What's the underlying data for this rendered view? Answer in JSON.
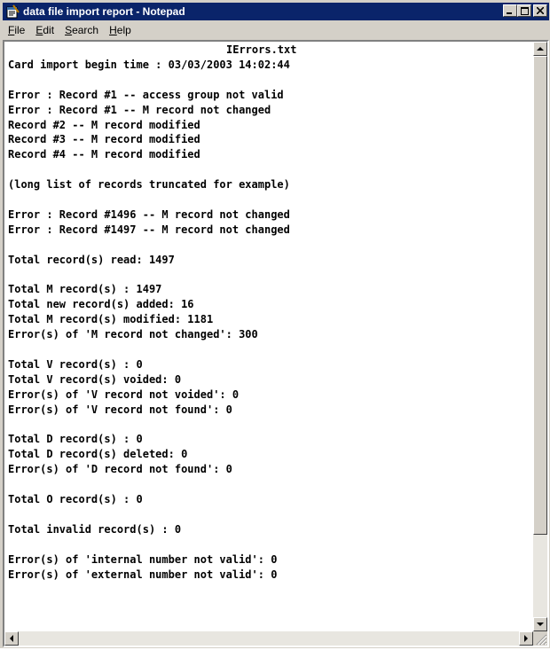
{
  "window": {
    "title": "data file import report - Notepad"
  },
  "menu": [
    {
      "label": "File",
      "key": "F",
      "rest": "ile"
    },
    {
      "label": "Edit",
      "key": "E",
      "rest": "dit"
    },
    {
      "label": "Search",
      "key": "S",
      "rest": "earch"
    },
    {
      "label": "Help",
      "key": "H",
      "rest": "elp"
    }
  ],
  "document": {
    "heading": "IErrors.txt",
    "lines": [
      "Card import begin time : 03/03/2003 14:02:44",
      "",
      "Error : Record #1 -- access group not valid",
      "Error : Record #1 -- M record not changed",
      "Record #2 -- M record modified",
      "Record #3 -- M record modified",
      "Record #4 -- M record modified",
      "",
      "(long list of records truncated for example)",
      "",
      "Error : Record #1496 -- M record not changed",
      "Error : Record #1497 -- M record not changed",
      "",
      "Total record(s) read: 1497",
      "",
      "Total M record(s) : 1497",
      "Total new record(s) added: 16",
      "Total M record(s) modified: 1181",
      "Error(s) of 'M record not changed': 300",
      "",
      "Total V record(s) : 0",
      "Total V record(s) voided: 0",
      "Error(s) of 'V record not voided': 0",
      "Error(s) of 'V record not found': 0",
      "",
      "Total D record(s) : 0",
      "Total D record(s) deleted: 0",
      "Error(s) of 'D record not found': 0",
      "",
      "Total O record(s) : 0",
      "",
      "Total invalid record(s) : 0",
      "",
      "Error(s) of 'internal number not valid': 0",
      "Error(s) of 'external number not valid': 0"
    ]
  },
  "icons": {
    "app": "notepad-icon",
    "minimize": "minimize-icon",
    "maximize": "maximize-icon",
    "close": "close-icon"
  }
}
